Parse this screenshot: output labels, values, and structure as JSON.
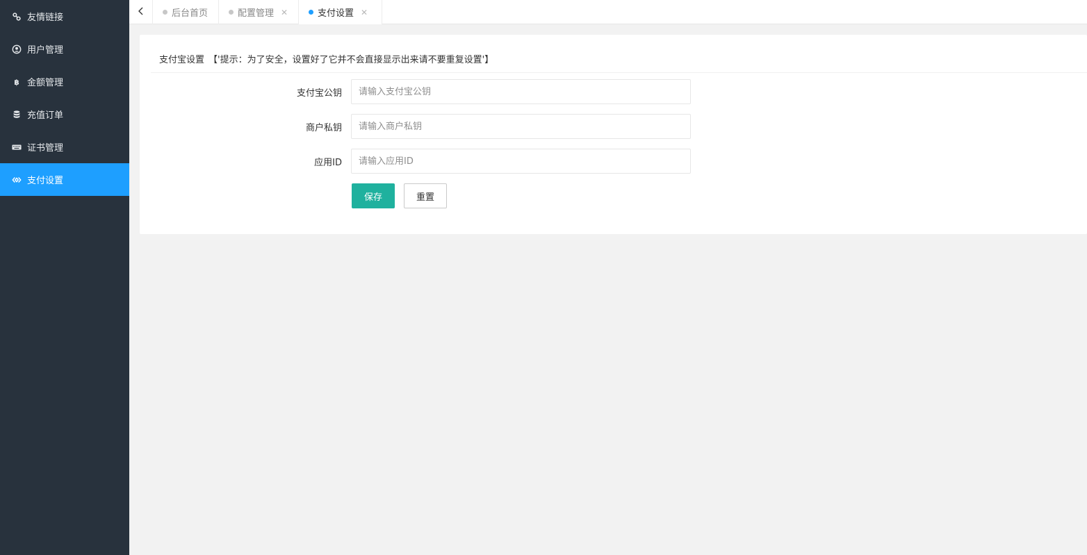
{
  "sidebar": {
    "items": [
      {
        "label": "友情链接",
        "icon": "link-icon",
        "active": false
      },
      {
        "label": "用户管理",
        "icon": "user-circle-icon",
        "active": false
      },
      {
        "label": "金额管理",
        "icon": "bitcoin-icon",
        "active": false
      },
      {
        "label": "充值订单",
        "icon": "database-icon",
        "active": false
      },
      {
        "label": "证书管理",
        "icon": "keyboard-icon",
        "active": false
      },
      {
        "label": "支付设置",
        "icon": "code-diamond-icon",
        "active": true
      }
    ]
  },
  "tabs": [
    {
      "label": "后台首页",
      "closable": false,
      "active": false
    },
    {
      "label": "配置管理",
      "closable": true,
      "active": false
    },
    {
      "label": "支付设置",
      "closable": true,
      "active": true
    }
  ],
  "card": {
    "title": "支付宝设置",
    "hint": "【'提示：为了安全，设置好了它并不会直接显示出来请不要重复设置'】"
  },
  "form": {
    "fields": [
      {
        "label": "支付宝公钥",
        "placeholder": "请输入支付宝公钥",
        "value": ""
      },
      {
        "label": "商户私钥",
        "placeholder": "请输入商户私钥",
        "value": ""
      },
      {
        "label": "应用ID",
        "placeholder": "请输入应用ID",
        "value": ""
      }
    ],
    "save_label": "保存",
    "reset_label": "重置"
  },
  "colors": {
    "sidebar_bg": "#28323d",
    "sidebar_active": "#1e9fff",
    "primary_button": "#1fb19e",
    "page_bg": "#f2f2f2"
  }
}
